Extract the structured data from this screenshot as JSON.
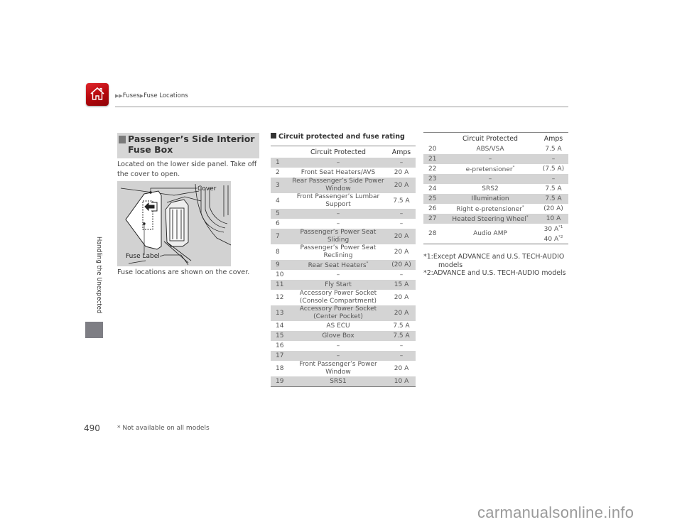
{
  "header": {
    "home_icon": "home-icon",
    "breadcrumb": [
      {
        "label": "Fuses"
      },
      {
        "label": "Fuse Locations"
      }
    ]
  },
  "side": {
    "chapter": "Handling the Unexpected"
  },
  "page_number": "490",
  "footnote": "* Not available on all models",
  "section": {
    "title": "Passenger’s Side Interior Fuse Box",
    "intro": "Located on the lower side panel. Take off the cover to open.",
    "diagram": {
      "callout_cover": "Cover",
      "callout_fuse_label": "Fuse Label"
    },
    "caption": "Fuse locations are shown on the cover."
  },
  "fuse_rating": {
    "subheading": "Circuit protected and fuse rating",
    "col_circuit": "Circuit Protected",
    "col_amps": "Amps",
    "table1": [
      {
        "n": "1",
        "circuit": "–",
        "amps": "–",
        "shade": true
      },
      {
        "n": "2",
        "circuit": "Front Seat Heaters/AVS",
        "amps": "20 A",
        "shade": false
      },
      {
        "n": "3",
        "circuit": "Rear Passenger’s Side Power Window",
        "amps": "20 A",
        "shade": true
      },
      {
        "n": "4",
        "circuit": "Front Passenger’s Lumbar Support",
        "amps": "7.5 A",
        "shade": false
      },
      {
        "n": "5",
        "circuit": "–",
        "amps": "–",
        "shade": true
      },
      {
        "n": "6",
        "circuit": "–",
        "amps": "–",
        "shade": false
      },
      {
        "n": "7",
        "circuit": "Passenger’s Power Seat Sliding",
        "amps": "20 A",
        "shade": true
      },
      {
        "n": "8",
        "circuit": "Passenger’s Power Seat Reclining",
        "amps": "20 A",
        "shade": false
      },
      {
        "n": "9",
        "circuit": "Rear Seat Heaters",
        "mark": "*",
        "amps": "(20 A)",
        "shade": true
      },
      {
        "n": "10",
        "circuit": "–",
        "amps": "–",
        "shade": false
      },
      {
        "n": "11",
        "circuit": "Fly Start",
        "amps": "15 A",
        "shade": true
      },
      {
        "n": "12",
        "circuit": "Accessory Power Socket (Console Compartment)",
        "amps": "20 A",
        "shade": false
      },
      {
        "n": "13",
        "circuit": "Accessory Power Socket (Center Pocket)",
        "amps": "20 A",
        "shade": true
      },
      {
        "n": "14",
        "circuit": "AS ECU",
        "amps": "7.5 A",
        "shade": false
      },
      {
        "n": "15",
        "circuit": "Glove Box",
        "amps": "7.5 A",
        "shade": true
      },
      {
        "n": "16",
        "circuit": "–",
        "amps": "–",
        "shade": false
      },
      {
        "n": "17",
        "circuit": "–",
        "amps": "–",
        "shade": true
      },
      {
        "n": "18",
        "circuit": "Front Passenger’s Power Window",
        "amps": "20 A",
        "shade": false
      },
      {
        "n": "19",
        "circuit": "SRS1",
        "amps": "10 A",
        "shade": true
      }
    ],
    "table2": [
      {
        "n": "20",
        "circuit": "ABS/VSA",
        "amps": "7.5 A",
        "shade": false
      },
      {
        "n": "21",
        "circuit": "–",
        "amps": "–",
        "shade": true
      },
      {
        "n": "22",
        "circuit": "e-pretensioner",
        "mark": "*",
        "amps": "(7.5 A)",
        "shade": false
      },
      {
        "n": "23",
        "circuit": "–",
        "amps": "–",
        "shade": true
      },
      {
        "n": "24",
        "circuit": "SRS2",
        "amps": "7.5 A",
        "shade": false
      },
      {
        "n": "25",
        "circuit": "Illumination",
        "amps": "7.5 A",
        "shade": true
      },
      {
        "n": "26",
        "circuit": "Right e-pretensioner",
        "mark": "*",
        "amps": "(20 A)",
        "shade": false
      },
      {
        "n": "27",
        "circuit": "Heated Steering Wheel",
        "mark": "*",
        "amps": "10 A",
        "shade": true
      },
      {
        "n": "28",
        "circuit": "Audio AMP",
        "amps": "30 A",
        "amps_mark": "*1",
        "amps2": "40 A",
        "amps2_mark": "*2",
        "shade": false
      }
    ],
    "notes": [
      {
        "key": "*1:",
        "text": "Except ADVANCE and U.S. TECH-AUDIO models"
      },
      {
        "key": "*2:",
        "text": "ADVANCE and U.S. TECH-AUDIO models"
      }
    ]
  },
  "watermark": "carmanualsonline.info",
  "colors": {
    "home_button": "#c4080e",
    "row_shade": "#d4d4d4",
    "section_head_bg": "#d6d6d6",
    "side_tab": "#7e7e84"
  }
}
